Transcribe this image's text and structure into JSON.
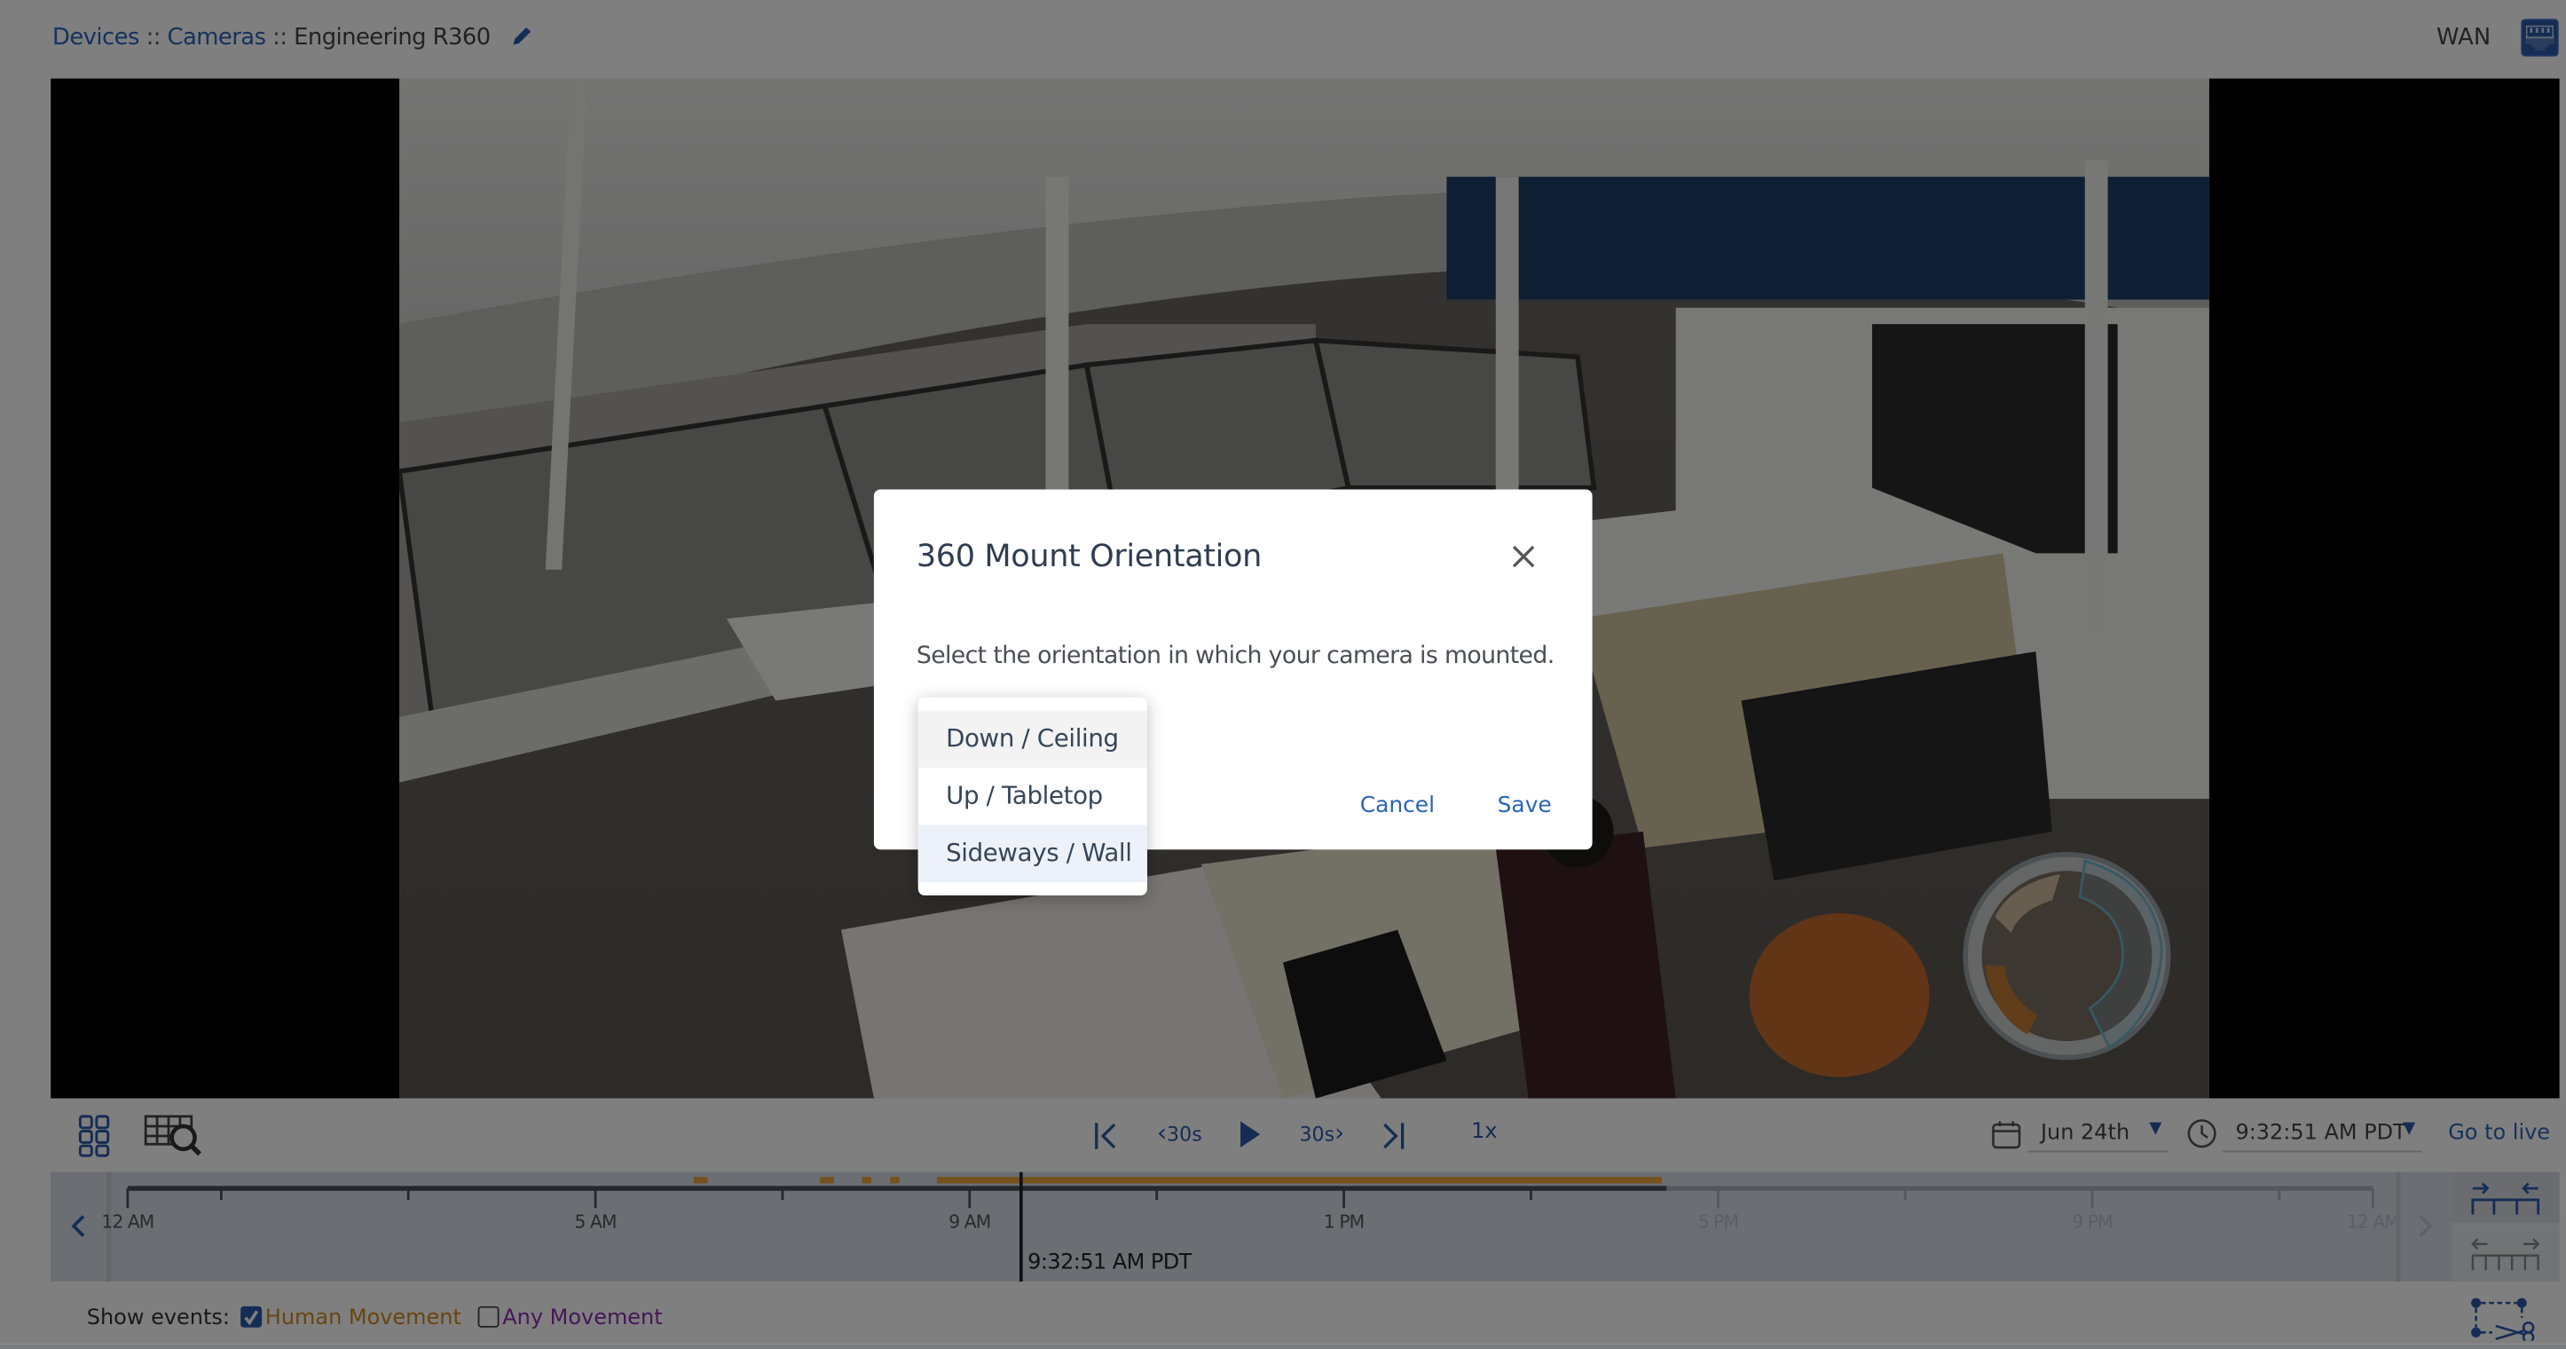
{
  "header": {
    "breadcrumb": [
      {
        "label": "Devices",
        "link": true
      },
      {
        "label": "Cameras",
        "link": true
      },
      {
        "label": "Engineering R360",
        "link": false
      }
    ],
    "separator": "::",
    "edit_icon": "pencil-icon",
    "network_label": "WAN",
    "network_icon": "ethernet-port-icon"
  },
  "video": {
    "minimap_icon": "fisheye-minimap"
  },
  "controls": {
    "grid_icon": "grid-view-icon",
    "search_icon": "motion-search-icon",
    "skip_start_icon": "skip-to-start-icon",
    "back_label": "30s",
    "play_icon": "play-icon",
    "forward_label": "30s",
    "skip_end_icon": "skip-to-end-icon",
    "speed": "1x",
    "date": "Jun 24th",
    "time": "9:32:51 AM PDT",
    "go_live": "Go to live"
  },
  "timeline": {
    "ticks": [
      {
        "label": "12 AM",
        "hour": 0,
        "future": false
      },
      {
        "label": "5 AM",
        "hour": 5,
        "future": false
      },
      {
        "label": "9 AM",
        "hour": 9,
        "future": false
      },
      {
        "label": "1 PM",
        "hour": 13,
        "future": false
      },
      {
        "label": "5 PM",
        "hour": 17,
        "future": true
      },
      {
        "label": "9 PM",
        "hour": 21,
        "future": true
      },
      {
        "label": "12 AM",
        "hour": 24,
        "future": true
      }
    ],
    "minor_ticks_hours": [
      1,
      3,
      7,
      11,
      15,
      19,
      23
    ],
    "events_hours": [
      [
        6.05,
        6.2
      ],
      [
        7.4,
        7.55
      ],
      [
        7.85,
        7.95
      ],
      [
        8.15,
        8.25
      ],
      [
        8.65,
        16.4
      ]
    ],
    "recorded_until_hour": 16.45,
    "playhead_hour": 9.55,
    "playhead_label": "9:32:51 AM PDT",
    "event_color": "#e8a43a"
  },
  "footer": {
    "show_events_label": "Show events:",
    "filters": [
      {
        "label": "Human Movement",
        "checked": true,
        "color": "#d48a1e"
      },
      {
        "label": "Any Movement",
        "checked": false,
        "color": "#8b2fb0"
      }
    ],
    "clip_icon": "clip-scissors-icon"
  },
  "dialog": {
    "title": "360 Mount Orientation",
    "description": "Select the orientation in which your camera is mounted.",
    "options": [
      {
        "label": "Down / Ceiling",
        "state": "hover"
      },
      {
        "label": "Up / Tabletop",
        "state": "normal"
      },
      {
        "label": "Sideways / Wall",
        "state": "selected"
      }
    ],
    "cancel_label": "Cancel",
    "save_label": "Save"
  },
  "colors": {
    "accent": "#2a64b8",
    "overlay": "rgba(0,0,0,0.5)"
  }
}
